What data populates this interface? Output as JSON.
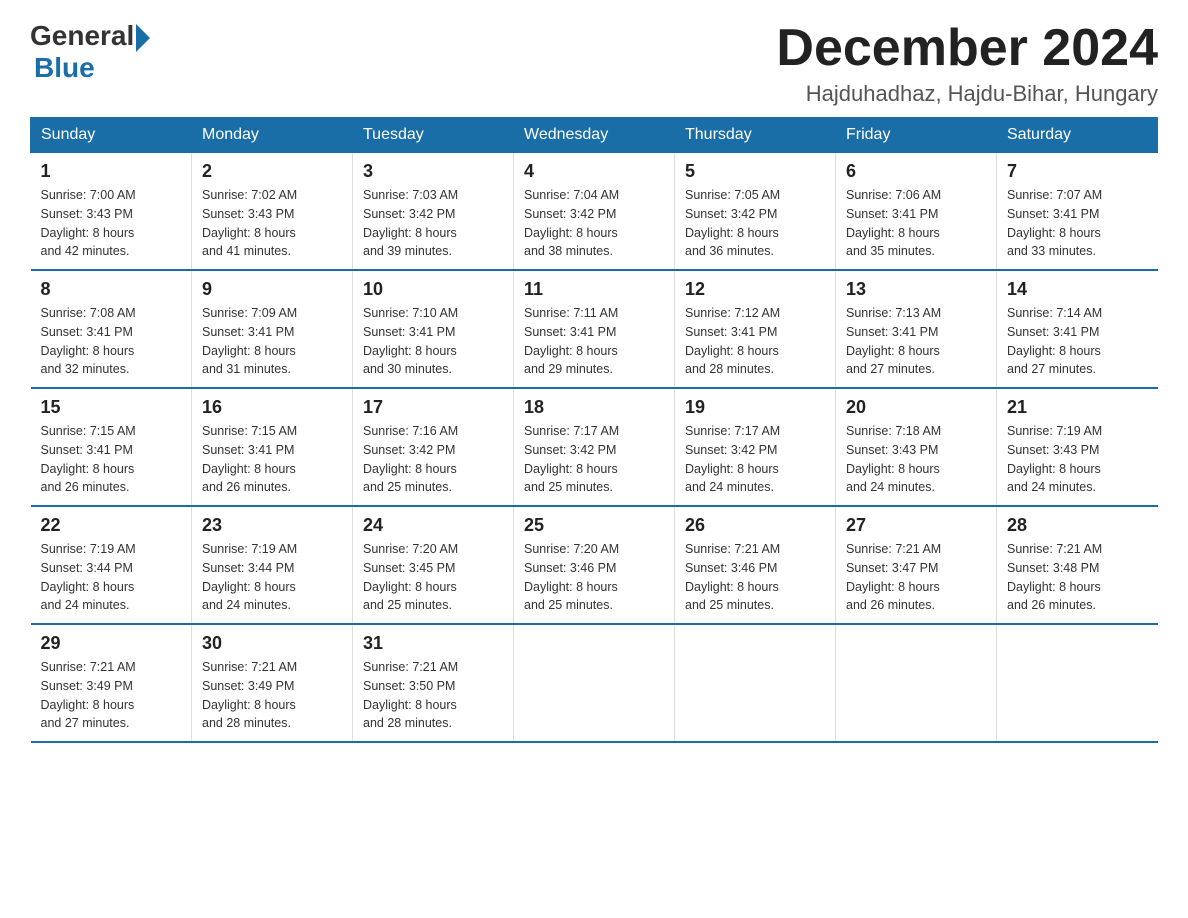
{
  "logo": {
    "general": "General",
    "blue": "Blue"
  },
  "title": {
    "month": "December 2024",
    "location": "Hajduhadhaz, Hajdu-Bihar, Hungary"
  },
  "weekdays": [
    "Sunday",
    "Monday",
    "Tuesday",
    "Wednesday",
    "Thursday",
    "Friday",
    "Saturday"
  ],
  "weeks": [
    [
      {
        "day": "1",
        "sunrise": "7:00 AM",
        "sunset": "3:43 PM",
        "daylight": "8 hours and 42 minutes."
      },
      {
        "day": "2",
        "sunrise": "7:02 AM",
        "sunset": "3:43 PM",
        "daylight": "8 hours and 41 minutes."
      },
      {
        "day": "3",
        "sunrise": "7:03 AM",
        "sunset": "3:42 PM",
        "daylight": "8 hours and 39 minutes."
      },
      {
        "day": "4",
        "sunrise": "7:04 AM",
        "sunset": "3:42 PM",
        "daylight": "8 hours and 38 minutes."
      },
      {
        "day": "5",
        "sunrise": "7:05 AM",
        "sunset": "3:42 PM",
        "daylight": "8 hours and 36 minutes."
      },
      {
        "day": "6",
        "sunrise": "7:06 AM",
        "sunset": "3:41 PM",
        "daylight": "8 hours and 35 minutes."
      },
      {
        "day": "7",
        "sunrise": "7:07 AM",
        "sunset": "3:41 PM",
        "daylight": "8 hours and 33 minutes."
      }
    ],
    [
      {
        "day": "8",
        "sunrise": "7:08 AM",
        "sunset": "3:41 PM",
        "daylight": "8 hours and 32 minutes."
      },
      {
        "day": "9",
        "sunrise": "7:09 AM",
        "sunset": "3:41 PM",
        "daylight": "8 hours and 31 minutes."
      },
      {
        "day": "10",
        "sunrise": "7:10 AM",
        "sunset": "3:41 PM",
        "daylight": "8 hours and 30 minutes."
      },
      {
        "day": "11",
        "sunrise": "7:11 AM",
        "sunset": "3:41 PM",
        "daylight": "8 hours and 29 minutes."
      },
      {
        "day": "12",
        "sunrise": "7:12 AM",
        "sunset": "3:41 PM",
        "daylight": "8 hours and 28 minutes."
      },
      {
        "day": "13",
        "sunrise": "7:13 AM",
        "sunset": "3:41 PM",
        "daylight": "8 hours and 27 minutes."
      },
      {
        "day": "14",
        "sunrise": "7:14 AM",
        "sunset": "3:41 PM",
        "daylight": "8 hours and 27 minutes."
      }
    ],
    [
      {
        "day": "15",
        "sunrise": "7:15 AM",
        "sunset": "3:41 PM",
        "daylight": "8 hours and 26 minutes."
      },
      {
        "day": "16",
        "sunrise": "7:15 AM",
        "sunset": "3:41 PM",
        "daylight": "8 hours and 26 minutes."
      },
      {
        "day": "17",
        "sunrise": "7:16 AM",
        "sunset": "3:42 PM",
        "daylight": "8 hours and 25 minutes."
      },
      {
        "day": "18",
        "sunrise": "7:17 AM",
        "sunset": "3:42 PM",
        "daylight": "8 hours and 25 minutes."
      },
      {
        "day": "19",
        "sunrise": "7:17 AM",
        "sunset": "3:42 PM",
        "daylight": "8 hours and 24 minutes."
      },
      {
        "day": "20",
        "sunrise": "7:18 AM",
        "sunset": "3:43 PM",
        "daylight": "8 hours and 24 minutes."
      },
      {
        "day": "21",
        "sunrise": "7:19 AM",
        "sunset": "3:43 PM",
        "daylight": "8 hours and 24 minutes."
      }
    ],
    [
      {
        "day": "22",
        "sunrise": "7:19 AM",
        "sunset": "3:44 PM",
        "daylight": "8 hours and 24 minutes."
      },
      {
        "day": "23",
        "sunrise": "7:19 AM",
        "sunset": "3:44 PM",
        "daylight": "8 hours and 24 minutes."
      },
      {
        "day": "24",
        "sunrise": "7:20 AM",
        "sunset": "3:45 PM",
        "daylight": "8 hours and 25 minutes."
      },
      {
        "day": "25",
        "sunrise": "7:20 AM",
        "sunset": "3:46 PM",
        "daylight": "8 hours and 25 minutes."
      },
      {
        "day": "26",
        "sunrise": "7:21 AM",
        "sunset": "3:46 PM",
        "daylight": "8 hours and 25 minutes."
      },
      {
        "day": "27",
        "sunrise": "7:21 AM",
        "sunset": "3:47 PM",
        "daylight": "8 hours and 26 minutes."
      },
      {
        "day": "28",
        "sunrise": "7:21 AM",
        "sunset": "3:48 PM",
        "daylight": "8 hours and 26 minutes."
      }
    ],
    [
      {
        "day": "29",
        "sunrise": "7:21 AM",
        "sunset": "3:49 PM",
        "daylight": "8 hours and 27 minutes."
      },
      {
        "day": "30",
        "sunrise": "7:21 AM",
        "sunset": "3:49 PM",
        "daylight": "8 hours and 28 minutes."
      },
      {
        "day": "31",
        "sunrise": "7:21 AM",
        "sunset": "3:50 PM",
        "daylight": "8 hours and 28 minutes."
      },
      null,
      null,
      null,
      null
    ]
  ],
  "labels": {
    "sunrise": "Sunrise: ",
    "sunset": "Sunset: ",
    "daylight": "Daylight: "
  }
}
